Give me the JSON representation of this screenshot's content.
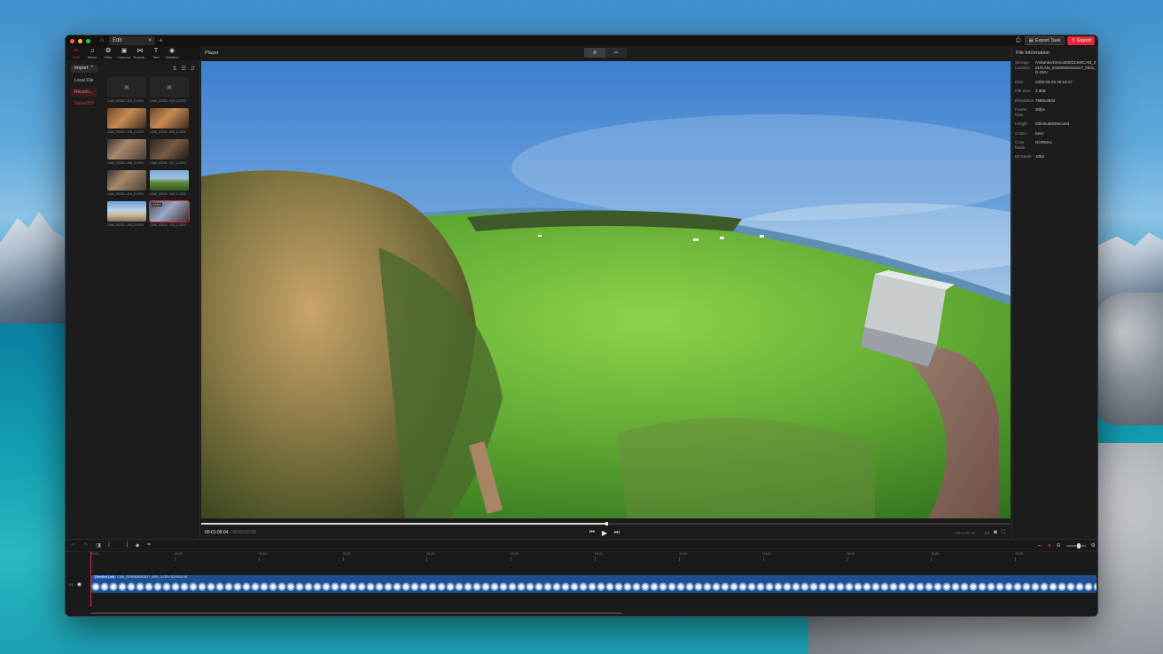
{
  "tabs": {
    "document": "Edit"
  },
  "topbar": {
    "export_task": "Export Task",
    "export": "Export"
  },
  "toolbar": {
    "items": [
      {
        "label": "Edit",
        "icon": "scissors-icon"
      },
      {
        "label": "Mixed",
        "icon": "music-icon"
      },
      {
        "label": "Filter",
        "icon": "filter-icon"
      },
      {
        "label": "Camera",
        "icon": "camera-icon"
      },
      {
        "label": "Transiti...",
        "icon": "transition-icon"
      },
      {
        "label": "Text",
        "icon": "text-icon"
      },
      {
        "label": "Stabilize",
        "icon": "stabilize-icon"
      }
    ]
  },
  "media": {
    "import_label": "Import",
    "folders": [
      "Local File",
      "Recent...",
      "Demo360"
    ],
    "thumbnails": [
      {
        "caption": "CAM_20230...001_D.OSV",
        "kind": "empty"
      },
      {
        "caption": "CAM_20230...002_D.OSV",
        "kind": "empty"
      },
      {
        "caption": "CAM_20230...005_D.OSV",
        "kind": "warm"
      },
      {
        "caption": "CAM_20230...006_D.OSV",
        "kind": "warm"
      },
      {
        "caption": "CAM_20230...008_D.OSV",
        "kind": "room"
      },
      {
        "caption": "CAM_20230...007_D.OSV",
        "kind": "dark"
      },
      {
        "caption": "CAM_20230...004_D.OSV",
        "kind": "room"
      },
      {
        "caption": "CAM_20230...003_D.OSV",
        "kind": "field"
      },
      {
        "caption": "CAM_20230...002_D.OSV",
        "kind": "beach"
      },
      {
        "caption": "CAM_20230...003_D.OSV",
        "kind": "active",
        "badge": "Added"
      }
    ]
  },
  "player": {
    "title": "Player",
    "current_time": "00:01:08:04",
    "total_time": "/ 00:03:02:18",
    "zoom_label": "Ultra HD 4K",
    "progress": 0.5
  },
  "info": {
    "title": "File Information",
    "rows": [
      {
        "key": "Storage Location",
        "value": "/Volumes/Osmo360/DCIM/CAM_001/CAM_20250526181617_0001_D.OSV"
      },
      {
        "key": "Date",
        "value": "2025-05-26 18:16:17"
      },
      {
        "key": "File Size",
        "value": "3.30B"
      },
      {
        "key": "Resolution",
        "value": "7680x3840"
      },
      {
        "key": "Frame Rate",
        "value": "30fps"
      },
      {
        "key": "Length",
        "value": "03minute02second"
      },
      {
        "key": "Codec",
        "value": "hevc"
      },
      {
        "key": "Color Mode",
        "value": "NORMAL"
      },
      {
        "key": "Bit Depth",
        "value": "10bit"
      }
    ]
  },
  "timeline": {
    "ticks": [
      "00:00",
      "00:05",
      "00:10",
      "00:15",
      "00:20",
      "00:25",
      "00:30",
      "00:35",
      "00:40",
      "00:45",
      "00:50",
      "00:55"
    ],
    "track_label": "V1",
    "clip_tag": "Direction Lock",
    "clip_name": "CAM_20250526181617_0001_D.OSV  00:03:02:18"
  }
}
